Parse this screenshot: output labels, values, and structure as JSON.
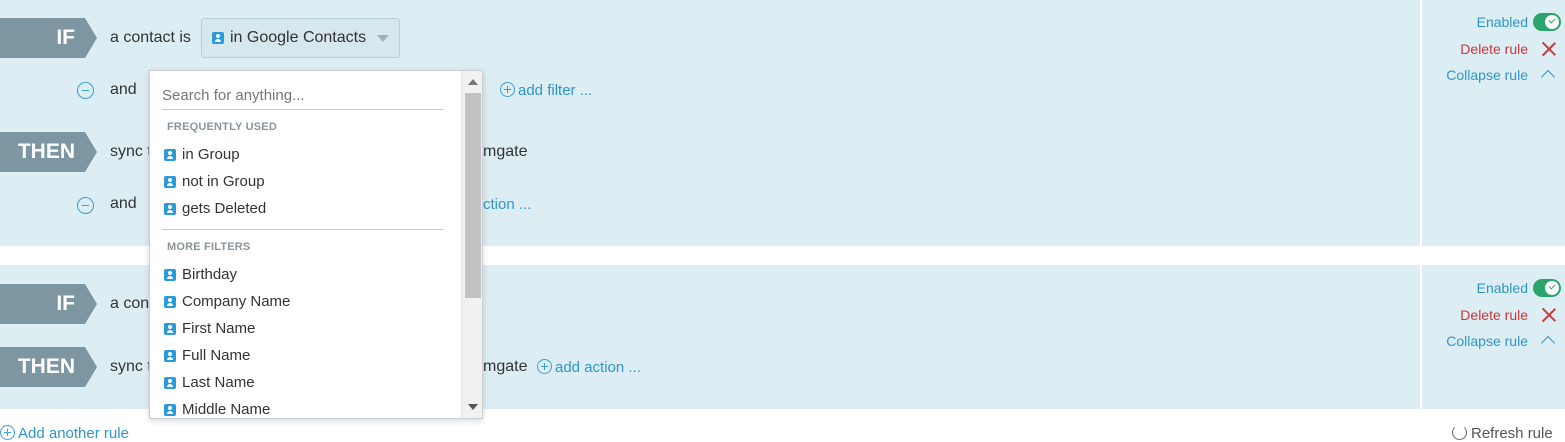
{
  "rules": [
    {
      "if_tag": "IF",
      "if_text": "a contact is",
      "selected_filter": "in Google Contacts",
      "and_label": "and",
      "add_filter": "add filter ...",
      "then_tag": "THEN",
      "then_text_left": "sync t",
      "then_text_right": "mgate",
      "then_and_label": "and",
      "add_action": "ction ...",
      "enabled_label": "Enabled",
      "enabled": true,
      "delete_label": "Delete rule",
      "collapse_label": "Collapse rule"
    },
    {
      "if_tag": "IF",
      "if_text": "a con",
      "then_tag": "THEN",
      "then_text_left": "sync t",
      "then_text_right": "mgate",
      "add_action": "add action ...",
      "enabled_label": "Enabled",
      "enabled": true,
      "delete_label": "Delete rule",
      "collapse_label": "Collapse rule"
    }
  ],
  "dropdown": {
    "search_placeholder": "Search for anything...",
    "frequent_heading": "FREQUENTLY USED",
    "frequent_items": [
      "in Group",
      "not in Group",
      "gets Deleted"
    ],
    "more_heading": "MORE FILTERS",
    "more_items": [
      "Birthday",
      "Company Name",
      "First Name",
      "Full Name",
      "Last Name",
      "Middle Name"
    ]
  },
  "footer": {
    "add_rule": "Add another rule",
    "refresh": "Refresh rule"
  },
  "colors": {
    "rule_bg": "#dcedf3",
    "tag_bg": "#7d96a2",
    "link": "#2f95c8",
    "delete": "#c9383a",
    "toggle_on": "#2aa56b"
  },
  "icons": {
    "contact": "contact-icon",
    "minus": "minus-circle-icon",
    "plus": "plus-circle-icon",
    "close": "close-icon",
    "collapse": "chevron-up-icon",
    "refresh": "refresh-icon"
  }
}
